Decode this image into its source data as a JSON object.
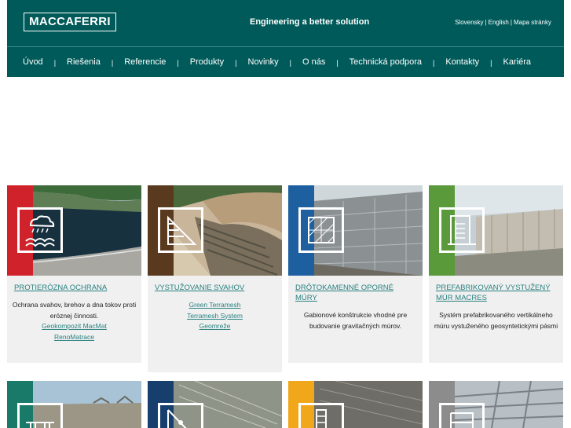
{
  "header": {
    "logo": "MACCAFERRI",
    "tagline": "Engineering a better solution",
    "top_links": [
      "Slovensky",
      "English",
      "Mapa stránky"
    ]
  },
  "nav": {
    "items": [
      "Úvod",
      "Riešenia",
      "Referencie",
      "Produkty",
      "Novinky",
      "O nás",
      "Technická podpora",
      "Kontakty",
      "Kariéra"
    ],
    "separator": "|"
  },
  "tiles": [
    {
      "title": "PROTIERÓZNA OCHRANA",
      "desc": "Ochrana svahov, brehov a dna tokov proti eróznej činnosti.",
      "links": [
        "Geokompozit MacMat",
        "RenoMatrace"
      ],
      "accent": "#d0222a"
    },
    {
      "title": "VYSTUŽOVANIE SVAHOV",
      "links": [
        "Green Terramesh",
        "Terramesh System",
        "Geomreže"
      ],
      "accent": "#5a3a1e"
    },
    {
      "title": "DRÔTOKAMENNÉ OPORNÉ MÚRY",
      "desc": "Gabionové konštrukcie vhodné pre budovanie gravitačných múrov.",
      "accent": "#1e5fa0"
    },
    {
      "title": "PREFABRIKOVANÝ VYSTUŽENÝ MÚR MACRES",
      "desc": "Systém prefabrikovaného vertikálneho múru vystuženého geosyntetickými pásmi",
      "accent": "#5a9a3a"
    },
    {
      "accent": "#1a7a6a"
    },
    {
      "accent": "#173f6e"
    },
    {
      "accent": "#f0a81a"
    },
    {
      "accent": "#8c8c8c"
    }
  ],
  "colors": {
    "header": "#005a5a",
    "link": "#2a8080"
  }
}
